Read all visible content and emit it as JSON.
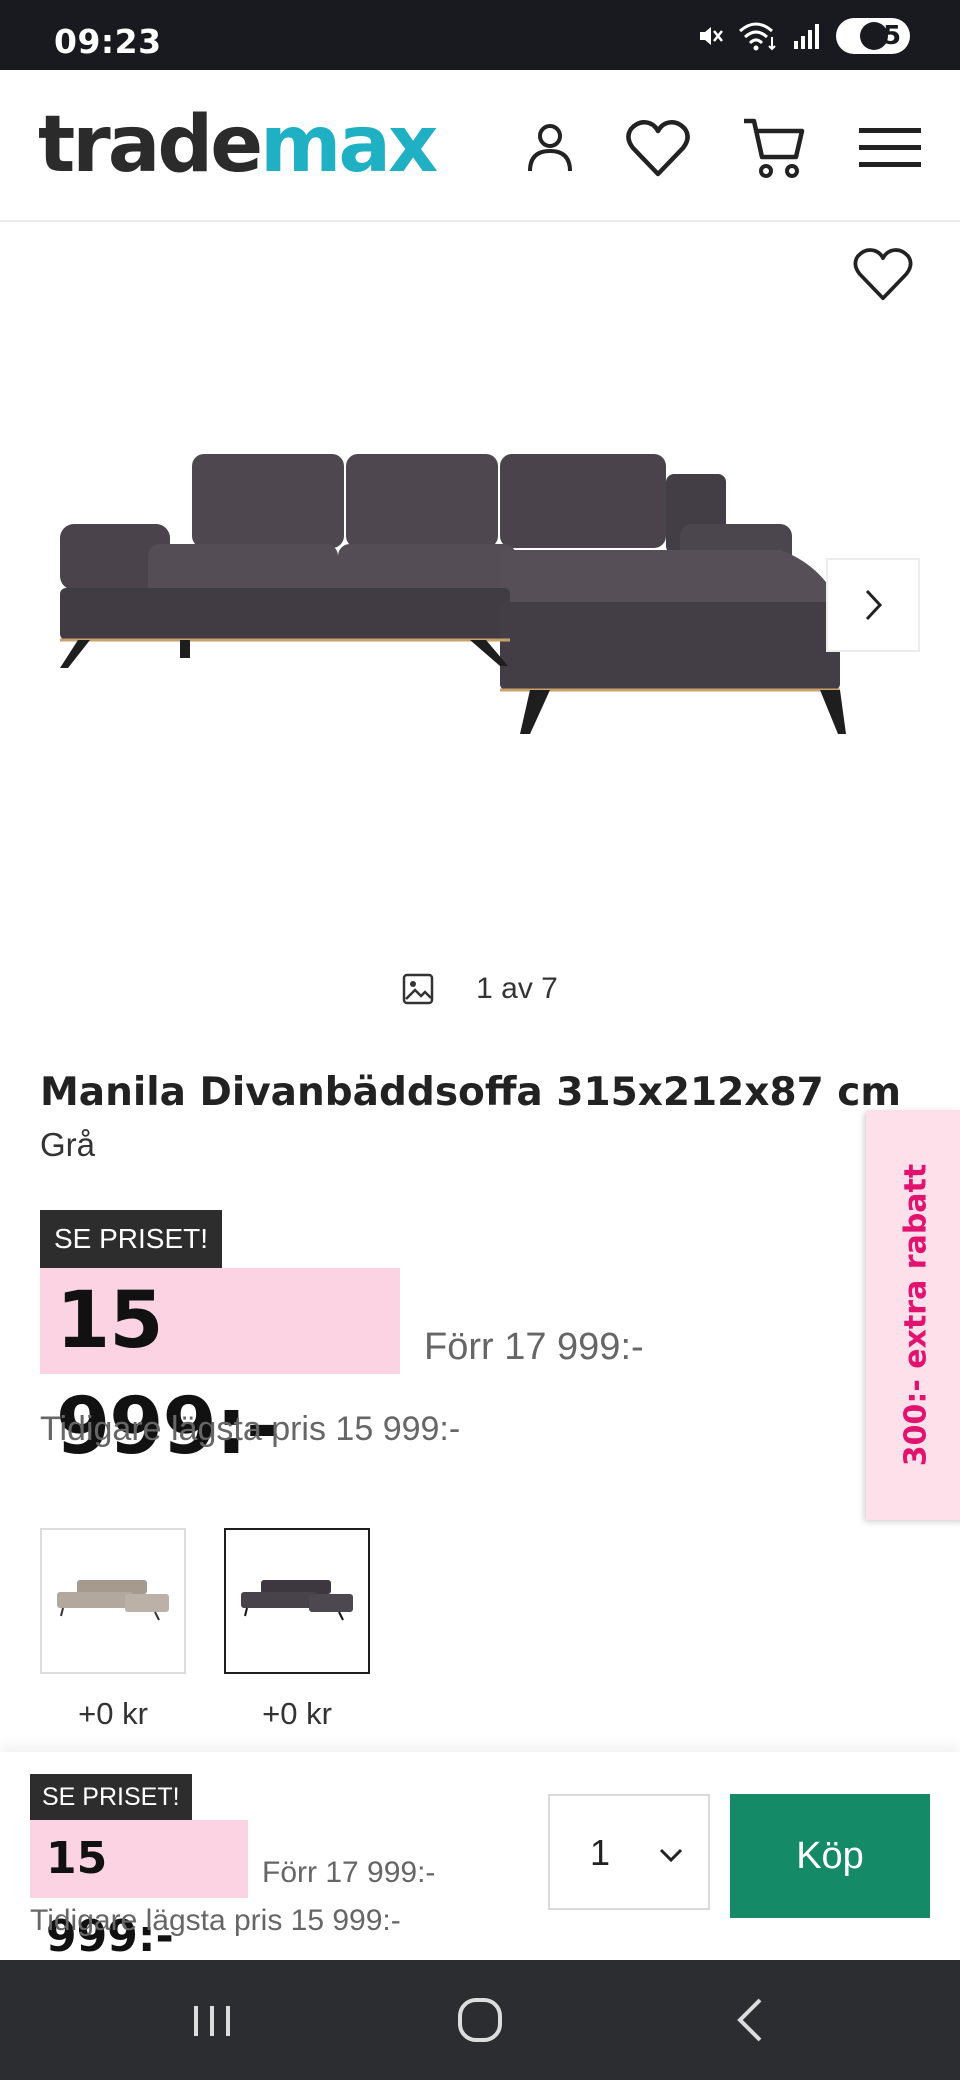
{
  "status_bar": {
    "time": "09:23",
    "battery": "55",
    "icons": [
      "mute-icon",
      "wifi-icon",
      "signal-icon",
      "battery-icon"
    ]
  },
  "header": {
    "logo_part1": "trade",
    "logo_part2": "max",
    "icons": [
      "account-icon",
      "wishlist-icon",
      "cart-icon",
      "menu-icon"
    ],
    "colors": {
      "logo_dark": "#2b2b2b",
      "logo_accent": "#1fb0c4"
    }
  },
  "gallery": {
    "counter": "1 av 7"
  },
  "product": {
    "title": "Manila Divanbäddsoffa 315x212x87 cm",
    "variant": "Grå",
    "badge": "SE PRISET!",
    "price": "15 999:-",
    "previous_price": "Förr 17 999:-",
    "lowest_price": "Tidigare lägsta pris 15 999:-"
  },
  "promo_tab": {
    "label": "300:- extra rabatt",
    "color": "#e2126f"
  },
  "swatches": [
    {
      "color_name": "beige",
      "price": "+0 kr",
      "selected": false
    },
    {
      "color_name": "grå",
      "price": "+0 kr",
      "selected": true
    }
  ],
  "buy_bar": {
    "badge": "SE PRISET!",
    "price": "15 999:-",
    "previous_price": "Förr 17 999:-",
    "lowest_price": "Tidigare lägsta pris 15 999:-",
    "quantity": "1",
    "buy_label": "Köp",
    "buy_color": "#148a66"
  },
  "nav_bar": {
    "icons": [
      "recent-apps-icon",
      "home-icon",
      "back-icon"
    ]
  }
}
